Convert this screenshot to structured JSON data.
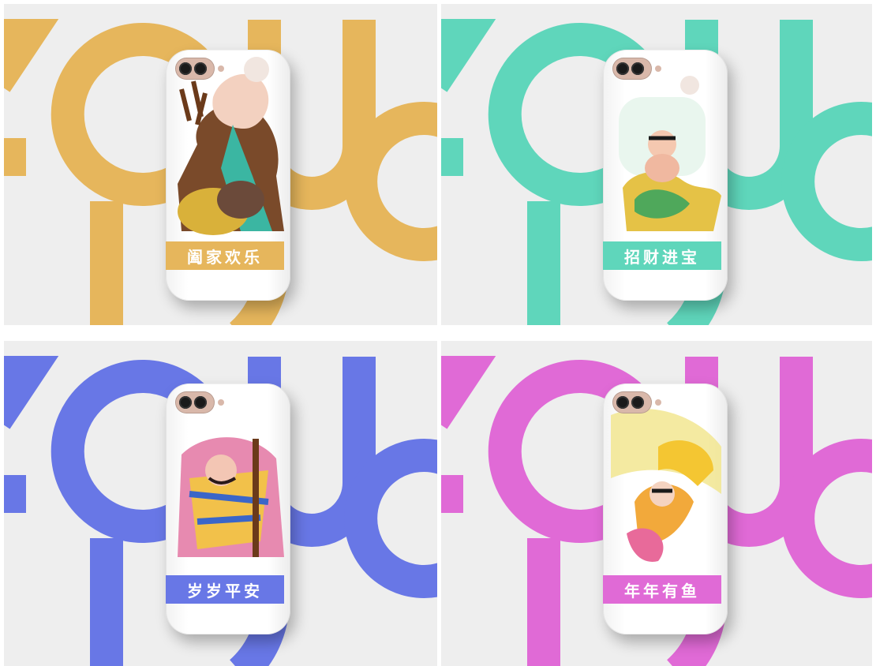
{
  "panels": [
    {
      "id": "gold",
      "color": "#e6b65c",
      "caption": "阖家欢乐"
    },
    {
      "id": "teal",
      "color": "#5fd6bb",
      "caption": "招财进宝"
    },
    {
      "id": "blue",
      "color": "#6877e6",
      "caption": "岁岁平安"
    },
    {
      "id": "pink",
      "color": "#e06ad6",
      "caption": "年年有鱼"
    }
  ]
}
